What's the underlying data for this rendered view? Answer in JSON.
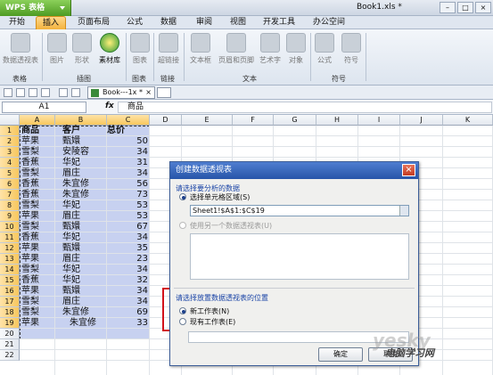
{
  "app": {
    "button_label": "WPS 表格",
    "doc_title": "Book1.xls *"
  },
  "menu_tabs": [
    "开始",
    "插入",
    "页面布局",
    "公式",
    "数据",
    "审阅",
    "视图",
    "开发工具",
    "办公空间"
  ],
  "active_tab": "插入",
  "ribbon": {
    "buttons": [
      {
        "label": "数据透视表",
        "icon": "pivot-table-icon"
      },
      {
        "label": "图片",
        "icon": "picture-icon"
      },
      {
        "label": "形状",
        "icon": "shape-icon"
      },
      {
        "label": "素材库",
        "icon": "clipart-library-icon"
      },
      {
        "label": "图表",
        "icon": "chart-icon"
      },
      {
        "label": "超链接",
        "icon": "hyperlink-icon"
      },
      {
        "label": "文本框",
        "icon": "textbox-icon"
      },
      {
        "label": "页眉和页脚",
        "icon": "header-footer-icon"
      },
      {
        "label": "艺术字",
        "icon": "wordart-icon"
      },
      {
        "label": "对象",
        "icon": "object-icon"
      },
      {
        "label": "公式",
        "icon": "equation-icon"
      },
      {
        "label": "符号",
        "icon": "symbol-icon"
      }
    ],
    "groups": [
      "表格",
      "插图",
      "图表",
      "链接",
      "文本",
      "符号"
    ]
  },
  "doc_tab": {
    "label": "Book---1x",
    "modified": "*",
    "close": "×"
  },
  "formula_bar": {
    "name_box": "A1",
    "fx": "fx",
    "content": "商品"
  },
  "columns": [
    "A",
    "B",
    "C",
    "D",
    "E",
    "F",
    "G",
    "H",
    "I",
    "J",
    "K"
  ],
  "rows": [
    "1",
    "2",
    "3",
    "4",
    "5",
    "6",
    "7",
    "8",
    "9",
    "10",
    "11",
    "12",
    "13",
    "14",
    "15",
    "16",
    "17",
    "18",
    "19",
    "20",
    "21",
    "22"
  ],
  "table": {
    "headers": [
      "商品",
      "客户",
      "总价"
    ],
    "data": [
      [
        "苹果",
        "甄嬛",
        "50"
      ],
      [
        "雪梨",
        "安陵容",
        "34"
      ],
      [
        "香蕉",
        "华妃",
        "31"
      ],
      [
        "雪梨",
        "眉庄",
        "34"
      ],
      [
        "香蕉",
        "朱宜修",
        "56"
      ],
      [
        "香蕉",
        "朱宜修",
        "73"
      ],
      [
        "雪梨",
        "华妃",
        "53"
      ],
      [
        "苹果",
        "眉庄",
        "53"
      ],
      [
        "雪梨",
        "甄嬛",
        "67"
      ],
      [
        "香蕉",
        "华妃",
        "34"
      ],
      [
        "苹果",
        "甄嬛",
        "35"
      ],
      [
        "苹果",
        "眉庄",
        "23"
      ],
      [
        "雪梨",
        "华妃",
        "34"
      ],
      [
        "香蕉",
        "华妃",
        "32"
      ],
      [
        "苹果",
        "甄嬛",
        "34"
      ],
      [
        "雪梨",
        "眉庄",
        "34"
      ],
      [
        "雪梨",
        "朱宜修",
        "69"
      ],
      [
        "苹果",
        "朱宜修",
        "33"
      ]
    ]
  },
  "dialog": {
    "title": "创建数据透视表",
    "close": "×",
    "section_data": "请选择要分析的数据",
    "opt_range": "选择单元格区域(S)",
    "range_value": "Sheet1!$A$1:$C$19",
    "opt_external": "使用另一个数据透视表(U)",
    "section_location": "请选择放置数据透视表的位置",
    "opt_new_sheet": "新工作表(N)",
    "opt_existing_sheet": "现有工作表(E)",
    "ok": "确定",
    "cancel": "取消"
  },
  "watermark": {
    "brand": "yesky",
    "site": "电脑学习网"
  }
}
